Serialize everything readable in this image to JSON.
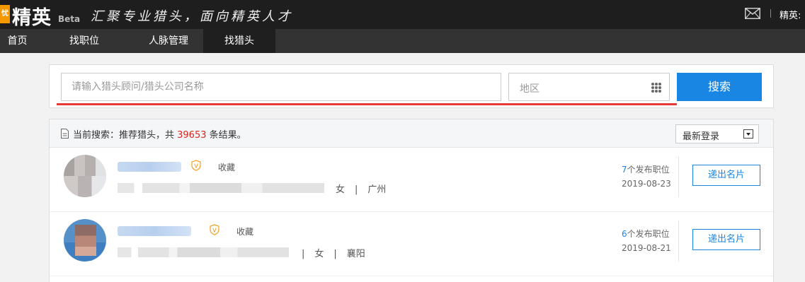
{
  "app": {
    "logo_badge": "忧",
    "logo_text": "精英",
    "logo_beta": "Beta",
    "slogan": "汇聚专业猎头，面向精英人才",
    "user_label": "精英:"
  },
  "nav": {
    "items": [
      {
        "label": "首页",
        "active": false
      },
      {
        "label": "找职位",
        "active": false
      },
      {
        "label": "人脉管理",
        "active": false
      },
      {
        "label": "找猎头",
        "active": true
      }
    ]
  },
  "search": {
    "placeholder": "请输入猎头顾问/猎头公司名称",
    "value": "",
    "region_label": "地区",
    "button_label": "搜索",
    "accent_color": "#1a86e4",
    "underline_color": "#e63a3a"
  },
  "results": {
    "summary_prefix": "当前搜索：推荐猎头，共 ",
    "count": "39653",
    "summary_suffix": " 条结果。",
    "sort_selected": "最新登录",
    "items": [
      {
        "favorite_label": "收藏",
        "gender": "女",
        "city": "广州",
        "jobs_count": "7",
        "jobs_suffix": "个发布职位",
        "date": "2019-08-23",
        "button_label": "递出名片"
      },
      {
        "favorite_label": "收藏",
        "gender": "女",
        "city": "襄阳",
        "jobs_count": "6",
        "jobs_suffix": "个发布职位",
        "date": "2019-08-21",
        "button_label": "递出名片"
      }
    ]
  },
  "icons": {
    "mail": "mail-icon",
    "region_grid": "grid-dots-icon",
    "doc": "document-icon",
    "vip": "vip-shield-icon",
    "sort_arrow": "chevron-down-icon"
  }
}
